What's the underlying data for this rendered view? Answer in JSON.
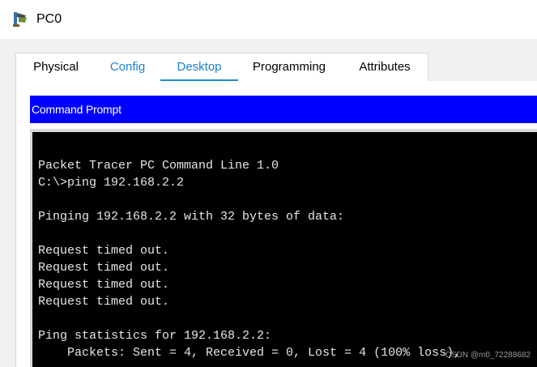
{
  "window": {
    "title": "PC0",
    "icon": "pc-icon"
  },
  "tabs": [
    {
      "label": "Physical",
      "active": false,
      "link": false
    },
    {
      "label": "Config",
      "active": false,
      "link": true
    },
    {
      "label": "Desktop",
      "active": true,
      "link": true
    },
    {
      "label": "Programming",
      "active": false,
      "link": false
    },
    {
      "label": "Attributes",
      "active": false,
      "link": false
    }
  ],
  "command_prompt": {
    "header": "Command Prompt",
    "lines": [
      "Packet Tracer PC Command Line 1.0",
      "C:\\>ping 192.168.2.2",
      "",
      "Pinging 192.168.2.2 with 32 bytes of data:",
      "",
      "Request timed out.",
      "Request timed out.",
      "Request timed out.",
      "Request timed out.",
      "",
      "Ping statistics for 192.168.2.2:",
      "    Packets: Sent = 4, Received = 0, Lost = 4 (100% loss),"
    ]
  },
  "watermark": "CSDN @m0_72288682",
  "colors": {
    "header_blue": "#0000ff",
    "tab_accent": "#1a8bd6",
    "terminal_bg": "#000000",
    "terminal_fg": "#e6e6e6"
  }
}
